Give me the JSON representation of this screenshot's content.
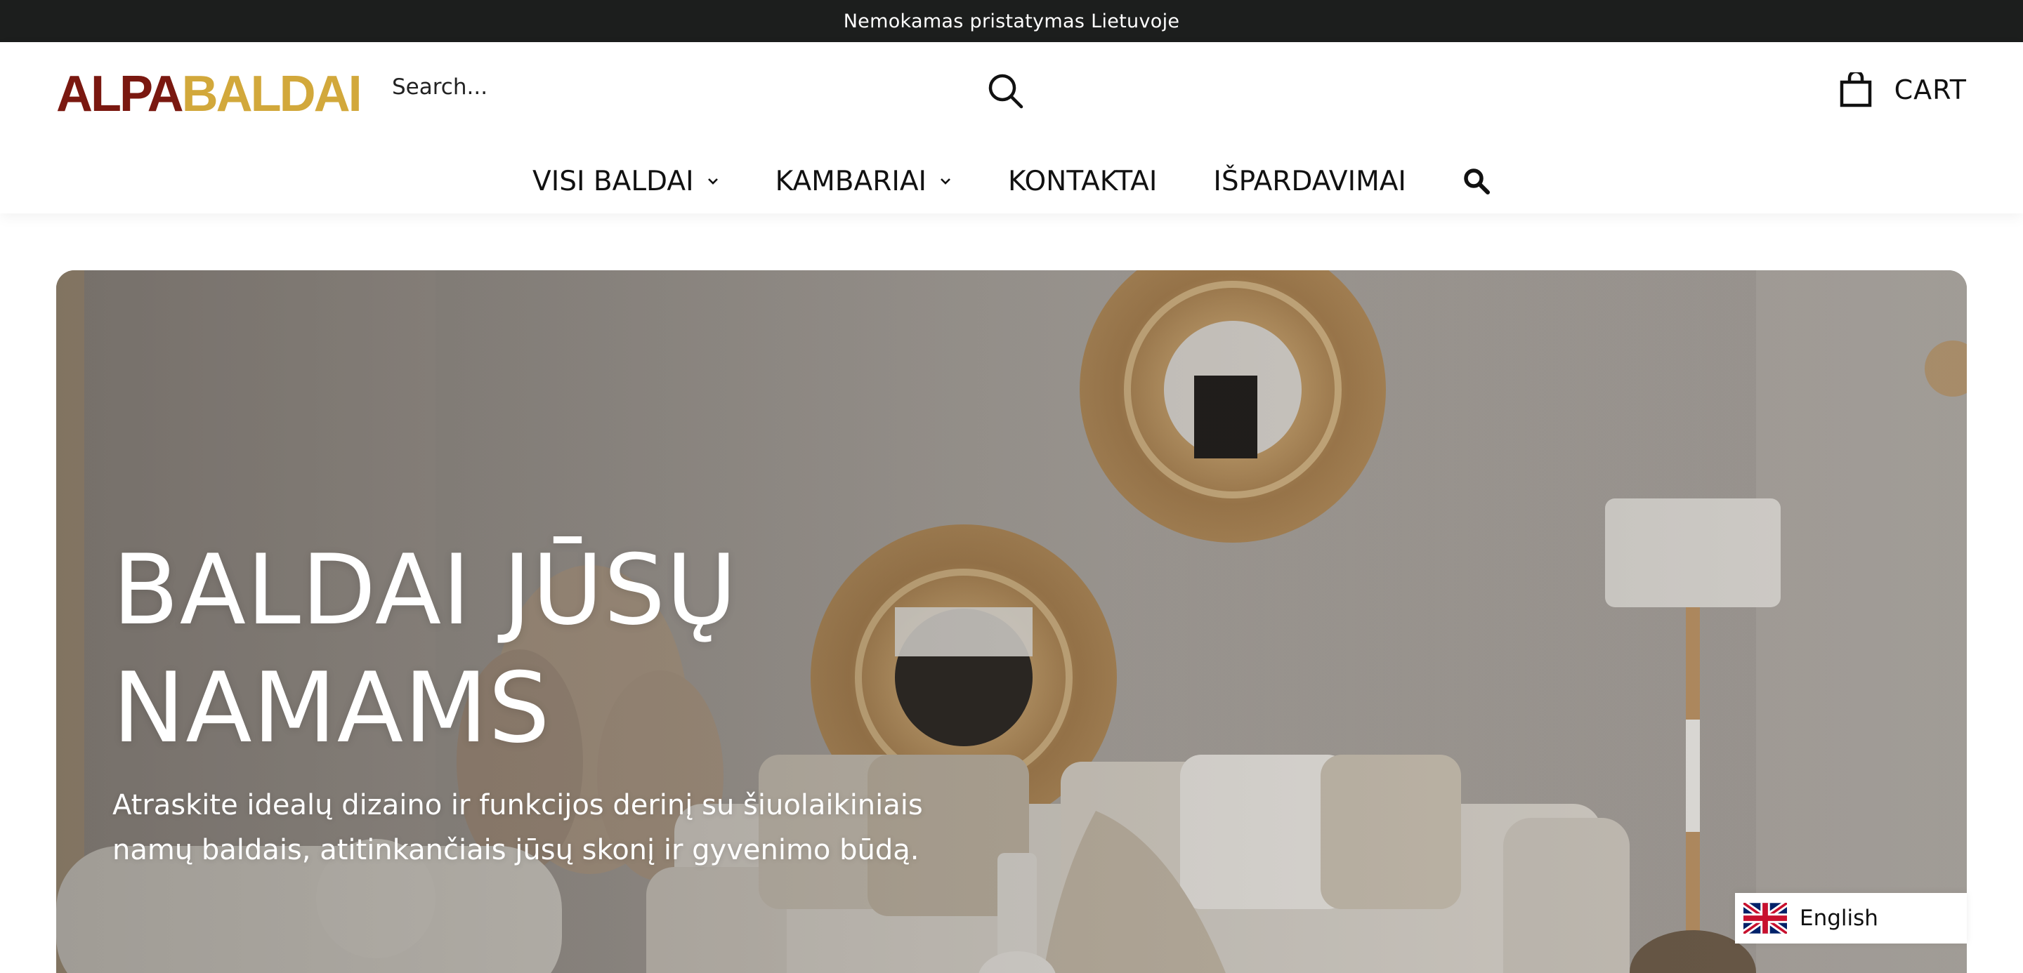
{
  "announcement": {
    "text": "Nemokamas pristatymas Lietuvoje"
  },
  "header": {
    "logo": {
      "part1": "ALPA",
      "part2": "BALDAI",
      "color1": "#7a1810",
      "color2": "#d2a83b"
    },
    "search": {
      "placeholder": "Search...",
      "icon": "search-icon"
    },
    "cart": {
      "label": "CART",
      "icon": "shopping-bag-icon"
    }
  },
  "nav": {
    "items": [
      {
        "label": "VISI BALDAI",
        "has_dropdown": true
      },
      {
        "label": "KAMBARIAI",
        "has_dropdown": true
      },
      {
        "label": "KONTAKTAI",
        "has_dropdown": false
      },
      {
        "label": "IŠPARDAVIMAI",
        "has_dropdown": false
      }
    ],
    "search_icon": "search-icon"
  },
  "hero": {
    "title_line1": "BALDAI JŪSŲ",
    "title_line2": "NAMAMS",
    "subtitle_line1": "Atraskite idealų dizaino ir funkcijos derinį su šiuolaikiniais",
    "subtitle_line2": "namų baldais, atitinkančiais jūsų skonį ir gyvenimo būdą."
  },
  "language_switcher": {
    "label": "English",
    "flag_icon": "uk-flag-icon"
  },
  "colors": {
    "announcement_bg": "#1c1e1d",
    "text": "#111111",
    "hero_text": "#ffffff"
  }
}
